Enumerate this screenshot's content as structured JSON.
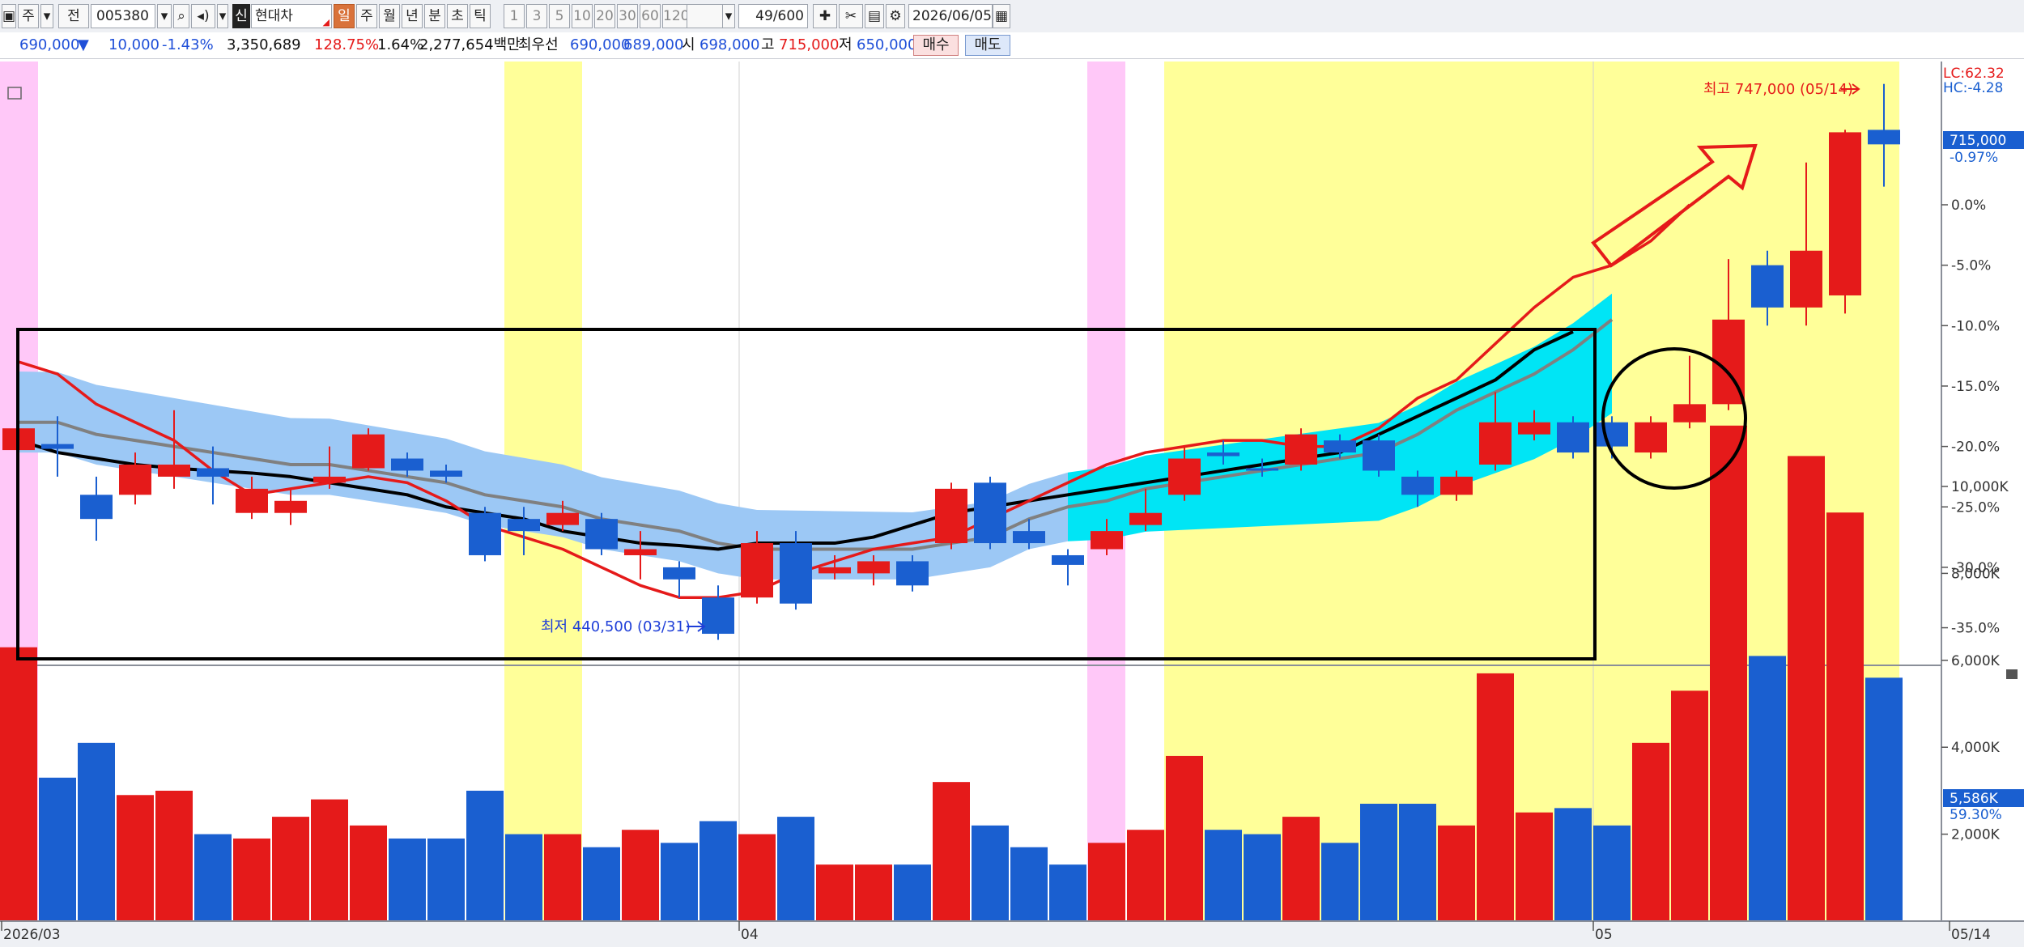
{
  "toolbar": {
    "period_label": "주",
    "prev_label": "전",
    "code_value": "005380",
    "badge_label": "신",
    "stock_name": "현대차",
    "periods": [
      "일",
      "주",
      "월",
      "년",
      "분",
      "초",
      "틱"
    ],
    "intervals": [
      "1",
      "3",
      "5",
      "10",
      "20",
      "30",
      "60",
      "120"
    ],
    "count": "49",
    "count_total": "/600",
    "date_value": "2026/06/05"
  },
  "info": {
    "price": "690,000",
    "change_arrow": "▼",
    "change": "10,000",
    "change_pct": "-1.43%",
    "volume": "3,350,689",
    "volume_pct": "128.75%",
    "turnover_pct": "1.64%",
    "amount": "2,277,654백만",
    "bid_label": "최우선",
    "ask": "690,000",
    "bid": "689,000",
    "open_label": "시",
    "open": "698,000",
    "high_label": "고",
    "high": "715,000",
    "low_label": "저",
    "low": "650,000",
    "buy_button": "매수",
    "sell_button": "매도"
  },
  "chart_data": {
    "type": "candlestick",
    "price_axis": {
      "ticks": [
        "-0.97%",
        "0.0%",
        "-5.0%",
        "-10.0%",
        "-15.0%",
        "-20.0%",
        "-25.0%",
        "-30.0%",
        "-35.0%"
      ],
      "current_tag": "715,000",
      "lc_label": "LC:62.32",
      "hc_label": "HC:-4.28"
    },
    "volume_axis": {
      "ticks": [
        "10,000K",
        "8,000K",
        "6,000K",
        "4,000K",
        "2,000K"
      ],
      "current_tag": "5,586K",
      "current_pct": "59.30%"
    },
    "date_labels": [
      "2026/03",
      "04",
      "05",
      "05/14"
    ],
    "annotations": {
      "max_label": "최고 747,000 (05/14)",
      "min_label": "최저 440,500 (03/31)"
    },
    "colors": {
      "up": "#e51a1a",
      "down": "#1a5fd0",
      "ma5": "#e51a1a",
      "ma20": "#808080",
      "ma60": "#000000",
      "cloud": "#00e5f5",
      "cloud_down": "#9cc8f5",
      "highlight_yellow": "#ffff99",
      "highlight_pink": "#ffc8f8"
    },
    "candles": [
      {
        "o": -18.5,
        "c": -20.3,
        "h": -18.0,
        "l": -21.0,
        "v": 6.3
      },
      {
        "o": -19.8,
        "c": -20.2,
        "h": -17.5,
        "l": -22.5,
        "v": 3.3
      },
      {
        "o": -24.0,
        "c": -26.0,
        "h": -22.5,
        "l": -27.8,
        "v": 4.1
      },
      {
        "o": -24.0,
        "c": -21.5,
        "h": -20.5,
        "l": -24.8,
        "v": 2.9
      },
      {
        "o": -22.5,
        "c": -21.5,
        "h": -17.0,
        "l": -23.5,
        "v": 3.0
      },
      {
        "o": -21.8,
        "c": -22.5,
        "h": -20.0,
        "l": -24.8,
        "v": 2.0
      },
      {
        "o": -25.5,
        "c": -23.5,
        "h": -22.5,
        "l": -26.0,
        "v": 1.9
      },
      {
        "o": -24.5,
        "c": -25.5,
        "h": -23.5,
        "l": -26.5,
        "v": 2.4
      },
      {
        "o": -23.0,
        "c": -22.5,
        "h": -20.0,
        "l": -23.5,
        "v": 2.8
      },
      {
        "o": -21.8,
        "c": -19.0,
        "h": -18.5,
        "l": -22.0,
        "v": 2.2
      },
      {
        "o": -21.0,
        "c": -22.0,
        "h": -20.5,
        "l": -22.5,
        "v": 1.9
      },
      {
        "o": -22.0,
        "c": -22.5,
        "h": -21.5,
        "l": -23.0,
        "v": 1.9
      },
      {
        "o": -25.5,
        "c": -29.0,
        "h": -25.0,
        "l": -29.5,
        "v": 3.0
      },
      {
        "o": -26.0,
        "c": -27.0,
        "h": -25.0,
        "l": -29.0,
        "v": 2.0
      },
      {
        "o": -26.5,
        "c": -25.5,
        "h": -24.5,
        "l": -27.0,
        "v": 2.0
      },
      {
        "o": -26.0,
        "c": -28.5,
        "h": -25.5,
        "l": -29.0,
        "v": 1.7
      },
      {
        "o": -29.0,
        "c": -28.5,
        "h": -27.0,
        "l": -31.0,
        "v": 2.1
      },
      {
        "o": -30.0,
        "c": -31.0,
        "h": -29.5,
        "l": -32.5,
        "v": 1.8
      },
      {
        "o": -32.5,
        "c": -35.5,
        "h": -31.5,
        "l": -36.0,
        "v": 2.3
      },
      {
        "o": -32.5,
        "c": -28.0,
        "h": -27.0,
        "l": -33.0,
        "v": 2.0
      },
      {
        "o": -28.0,
        "c": -33.0,
        "h": -27.0,
        "l": -33.5,
        "v": 2.4
      },
      {
        "o": -30.5,
        "c": -30.0,
        "h": -29.0,
        "l": -31.0,
        "v": 1.3
      },
      {
        "o": -30.5,
        "c": -29.5,
        "h": -29.0,
        "l": -31.5,
        "v": 1.3
      },
      {
        "o": -29.5,
        "c": -31.5,
        "h": -29.0,
        "l": -32.0,
        "v": 1.3
      },
      {
        "o": -28.0,
        "c": -23.5,
        "h": -23.0,
        "l": -28.5,
        "v": 3.2
      },
      {
        "o": -23.0,
        "c": -28.0,
        "h": -22.5,
        "l": -28.5,
        "v": 2.2
      },
      {
        "o": -27.0,
        "c": -28.0,
        "h": -26.0,
        "l": -28.5,
        "v": 1.7
      },
      {
        "o": -29.0,
        "c": -29.8,
        "h": -28.5,
        "l": -31.5,
        "v": 1.3
      },
      {
        "o": -28.5,
        "c": -27.0,
        "h": -26.0,
        "l": -29.0,
        "v": 1.8
      },
      {
        "o": -26.5,
        "c": -25.5,
        "h": -23.5,
        "l": -27.0,
        "v": 2.1
      },
      {
        "o": -24.0,
        "c": -21.0,
        "h": -20.0,
        "l": -24.5,
        "v": 3.8
      },
      {
        "o": -20.5,
        "c": -20.8,
        "h": -19.5,
        "l": -21.5,
        "v": 2.1
      },
      {
        "o": -22.0,
        "c": -21.8,
        "h": -21.0,
        "l": -22.5,
        "v": 2.0
      },
      {
        "o": -21.5,
        "c": -19.0,
        "h": -18.5,
        "l": -22.0,
        "v": 2.4
      },
      {
        "o": -19.5,
        "c": -20.5,
        "h": -19.0,
        "l": -21.0,
        "v": 1.8
      },
      {
        "o": -19.5,
        "c": -22.0,
        "h": -19.0,
        "l": -22.5,
        "v": 2.7
      },
      {
        "o": -22.5,
        "c": -24.0,
        "h": -22.0,
        "l": -25.0,
        "v": 2.7
      },
      {
        "o": -24.0,
        "c": -22.5,
        "h": -22.0,
        "l": -24.5,
        "v": 2.2
      },
      {
        "o": -21.5,
        "c": -18.0,
        "h": -15.5,
        "l": -22.0,
        "v": 5.7
      },
      {
        "o": -19.0,
        "c": -18.0,
        "h": -17.0,
        "l": -19.5,
        "v": 2.5
      },
      {
        "o": -18.0,
        "c": -20.5,
        "h": -17.5,
        "l": -21.0,
        "v": 2.6
      },
      {
        "o": -20.0,
        "c": -18.0,
        "h": -17.5,
        "l": -21.0,
        "v": 2.2
      },
      {
        "o": -20.5,
        "c": -18.0,
        "h": -17.5,
        "l": -21.0,
        "v": 4.1
      },
      {
        "o": -18.0,
        "c": -16.5,
        "h": -12.5,
        "l": -18.5,
        "v": 5.3
      },
      {
        "o": -16.5,
        "c": -9.5,
        "h": -4.5,
        "l": -17.0,
        "v": 11.4
      },
      {
        "o": -8.5,
        "c": -5.0,
        "h": -3.8,
        "l": -10.0,
        "v": 6.1
      },
      {
        "o": -3.8,
        "c": -8.5,
        "h": 3.5,
        "l": -10.0,
        "v": 10.7
      },
      {
        "o": -7.5,
        "c": 6.0,
        "h": 6.2,
        "l": -9.0,
        "v": 9.4
      },
      {
        "o": 6.2,
        "c": 5.0,
        "h": 10.0,
        "l": 1.5,
        "v": 5.6
      }
    ],
    "up_flags": [
      1,
      0,
      0,
      1,
      1,
      0,
      1,
      1,
      1,
      1,
      0,
      0,
      0,
      0,
      1,
      0,
      1,
      0,
      0,
      1,
      0,
      1,
      1,
      0,
      1,
      0,
      0,
      0,
      1,
      1,
      1,
      0,
      0,
      1,
      0,
      0,
      0,
      1,
      1,
      1,
      0,
      0,
      1,
      1,
      1,
      0,
      1,
      1,
      0
    ],
    "ma5": [
      -13.0,
      -14.0,
      -16.5,
      -18.0,
      -19.5,
      -22.0,
      -24.0,
      -23.5,
      -23.0,
      -22.5,
      -23.0,
      -24.5,
      -26.5,
      -27.5,
      -28.5,
      -30.0,
      -31.5,
      -32.5,
      -32.5,
      -32.0,
      -30.5,
      -29.5,
      -28.5,
      -28.0,
      -27.5,
      -26.0,
      -24.5,
      -23.0,
      -21.5,
      -20.5,
      -20.0,
      -19.5,
      -19.5,
      -20.0,
      -20.0,
      -18.5,
      -16.0,
      -14.5,
      -11.5,
      -8.5,
      -6.0,
      -5.0,
      -3.0,
      0.0
    ],
    "ma20": [
      -18.0,
      -18.0,
      -19.0,
      -19.5,
      -20.0,
      -20.5,
      -21.0,
      -21.5,
      -21.5,
      -22.0,
      -22.5,
      -23.0,
      -24.0,
      -24.5,
      -25.0,
      -26.0,
      -26.5,
      -27.0,
      -28.0,
      -28.5,
      -28.5,
      -28.5,
      -28.5,
      -28.5,
      -28.0,
      -27.5,
      -26.0,
      -25.0,
      -24.5,
      -23.5,
      -23.0,
      -22.5,
      -22.0,
      -21.5,
      -21.0,
      -20.5,
      -19.0,
      -17.0,
      -15.5,
      -14.0,
      -12.0,
      -9.5
    ],
    "ma60": [
      -19.5,
      -20.5,
      -21.0,
      -21.5,
      -21.8,
      -22.0,
      -22.2,
      -22.5,
      -23.0,
      -23.5,
      -24.0,
      -25.0,
      -25.5,
      -26.0,
      -27.0,
      -27.5,
      -28.0,
      -28.2,
      -28.5,
      -28.0,
      -28.0,
      -28.0,
      -27.5,
      -26.5,
      -25.5,
      -25.0,
      -24.5,
      -24.0,
      -23.5,
      -23.0,
      -22.5,
      -22.0,
      -21.5,
      -21.0,
      -20.5,
      -19.0,
      -17.5,
      -16.0,
      -14.5,
      -12.0,
      -10.5
    ]
  }
}
